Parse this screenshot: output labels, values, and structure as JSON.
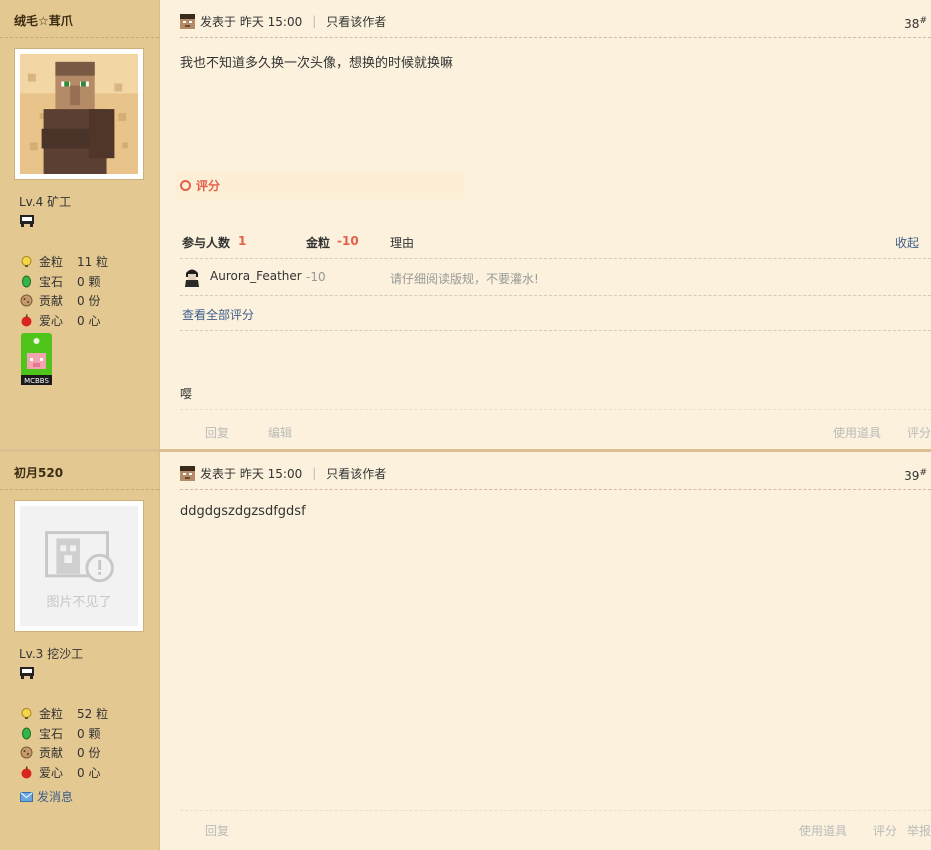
{
  "posts": [
    {
      "username": "绒毛☆茸爪",
      "level": "Lv.4 矿工",
      "stats": [
        {
          "label": "金粒",
          "value": "11 粒",
          "icon": "gold-nugget-icon"
        },
        {
          "label": "宝石",
          "value": "0 颗",
          "icon": "emerald-icon"
        },
        {
          "label": "贡献",
          "value": "0 份",
          "icon": "cookie-icon"
        },
        {
          "label": "爱心",
          "value": "0 心",
          "icon": "apple-icon"
        }
      ],
      "badge_text": "MCBBS",
      "posted": "发表于 昨天 15:00",
      "author_only": "只看该作者",
      "floor": "38",
      "floor_mark": "#",
      "content": "我也不知道多久换一次头像，想换的时候就换嘛",
      "rating": {
        "title": "评分",
        "participants_label": "参与人数",
        "participants": "1",
        "gold_label": "金粒",
        "gold": "-10",
        "reason_label": "理由",
        "collapse": "收起",
        "rows": [
          {
            "user": "Aurora_Feather",
            "value": "-10",
            "reason": "请仔细阅读版规，不要灌水!"
          }
        ],
        "view_all": "查看全部评分"
      },
      "signature": "嘤",
      "actions": {
        "reply": "回复",
        "edit": "编辑",
        "use_item": "使用道具",
        "rate": "评分"
      }
    },
    {
      "username": "初月520",
      "level": "Lv.3 挖沙工",
      "stats": [
        {
          "label": "金粒",
          "value": "52 粒",
          "icon": "gold-nugget-icon"
        },
        {
          "label": "宝石",
          "value": "0 颗",
          "icon": "emerald-icon"
        },
        {
          "label": "贡献",
          "value": "0 份",
          "icon": "cookie-icon"
        },
        {
          "label": "爱心",
          "value": "0 心",
          "icon": "apple-icon"
        }
      ],
      "avatar_missing_text": "图片不见了",
      "send_message": "发消息",
      "posted": "发表于 昨天 15:00",
      "author_only": "只看该作者",
      "floor": "39",
      "floor_mark": "#",
      "content": "ddgdgszdgzsdfgdsf",
      "actions": {
        "reply": "回复",
        "use_item": "使用道具",
        "rate": "评分",
        "report": "举报"
      }
    }
  ],
  "colors": {
    "accent_red": "#e3604b",
    "link_blue": "#3d5e8a",
    "sidebar": "#e4c891",
    "content_bg": "#fbf1dc"
  }
}
